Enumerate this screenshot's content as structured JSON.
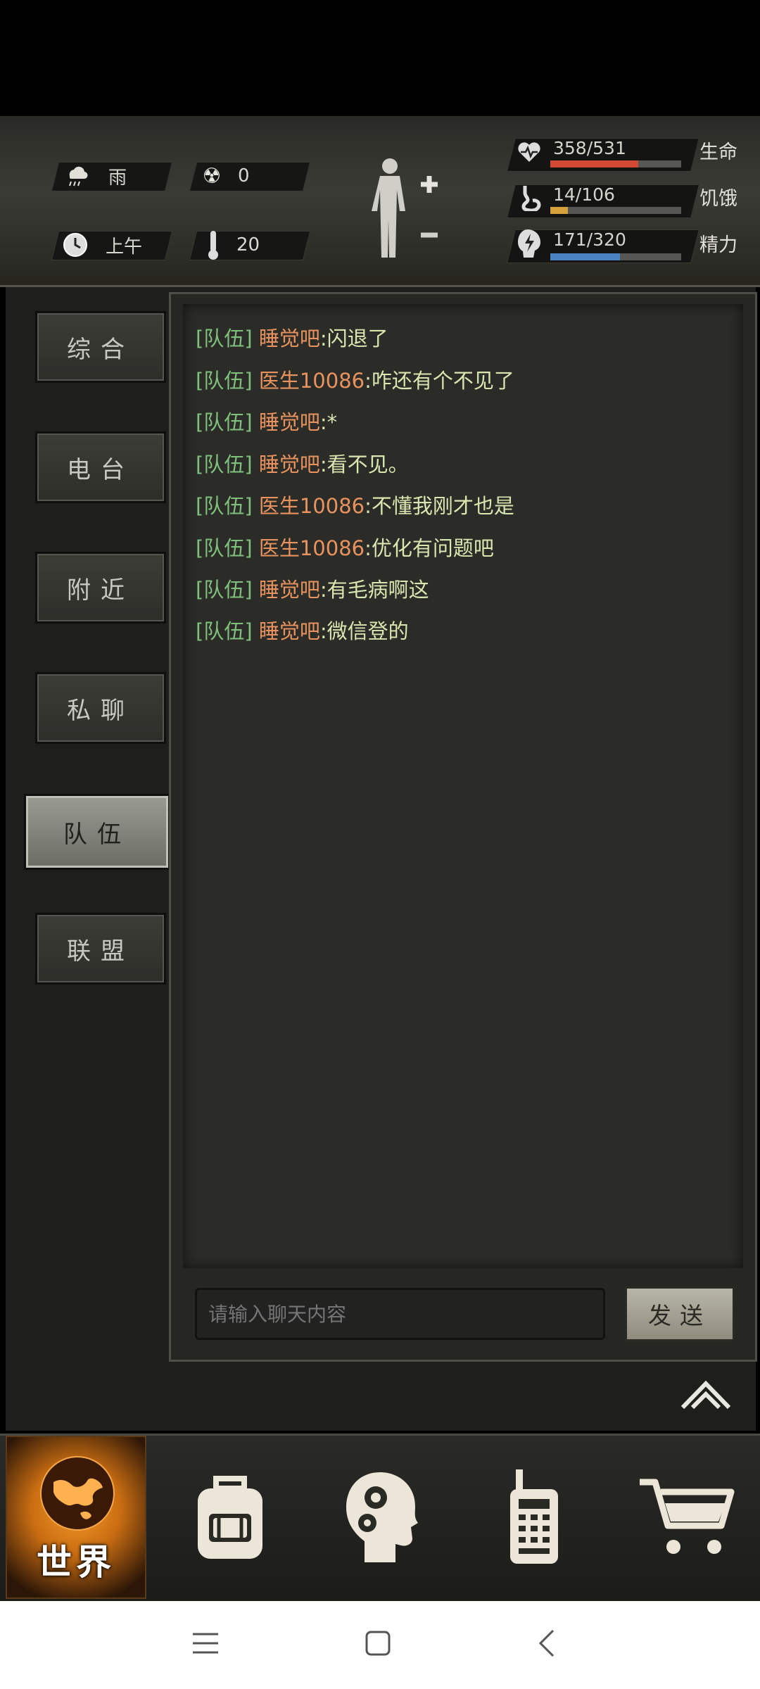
{
  "status": {
    "weather": {
      "icon": "rain-cloud-icon",
      "label": "雨"
    },
    "radiation": {
      "icon": "radiation-icon",
      "value": "0"
    },
    "time": {
      "icon": "clock-icon",
      "label": "上午"
    },
    "temperature": {
      "icon": "thermometer-icon",
      "value": "20"
    },
    "bars": [
      {
        "name": "life",
        "icon": "heart-pulse-icon",
        "value_text": "358/531",
        "label": "生命",
        "fraction": 0.674,
        "color": "#d24a35"
      },
      {
        "name": "hunger",
        "icon": "stomach-icon",
        "value_text": "14/106",
        "label": "饥饿",
        "fraction": 0.132,
        "color": "#d6a03b"
      },
      {
        "name": "energy",
        "icon": "energy-icon",
        "value_text": "171/320",
        "label": "精力",
        "fraction": 0.534,
        "color": "#4b82c2"
      }
    ]
  },
  "tabs": [
    {
      "label": "综合",
      "active": false
    },
    {
      "label": "电台",
      "active": false
    },
    {
      "label": "附近",
      "active": false
    },
    {
      "label": "私聊",
      "active": false
    },
    {
      "label": "队伍",
      "active": true
    },
    {
      "label": "联盟",
      "active": false
    }
  ],
  "chat": {
    "messages": [
      {
        "tag": "[队伍]",
        "name": "睡觉吧",
        "text": ":闪退了"
      },
      {
        "tag": "[队伍]",
        "name": "医生10086",
        "text": ":咋还有个不见了"
      },
      {
        "tag": "[队伍]",
        "name": "睡觉吧",
        "text": ":*"
      },
      {
        "tag": "[队伍]",
        "name": "睡觉吧",
        "text": ":看不见。"
      },
      {
        "tag": "[队伍]",
        "name": "医生10086",
        "text": ":不懂我刚才也是"
      },
      {
        "tag": "[队伍]",
        "name": "医生10086",
        "text": ":优化有问题吧"
      },
      {
        "tag": "[队伍]",
        "name": "睡觉吧",
        "text": ":有毛病啊这"
      },
      {
        "tag": "[队伍]",
        "name": "睡觉吧",
        "text": ":微信登的"
      }
    ],
    "input_placeholder": "请输入聊天内容",
    "send_label": "发送"
  },
  "bottom_nav": [
    {
      "name": "world",
      "icon": "globe-icon",
      "label": "世界",
      "active": true
    },
    {
      "name": "backpack",
      "icon": "backpack-icon"
    },
    {
      "name": "skills",
      "icon": "head-gears-icon"
    },
    {
      "name": "radio",
      "icon": "walkie-talkie-icon"
    },
    {
      "name": "shop",
      "icon": "cart-icon"
    }
  ],
  "colors": {
    "name": "#e8935f",
    "tag": "#7fc07c",
    "message": "#d8e6b0"
  }
}
